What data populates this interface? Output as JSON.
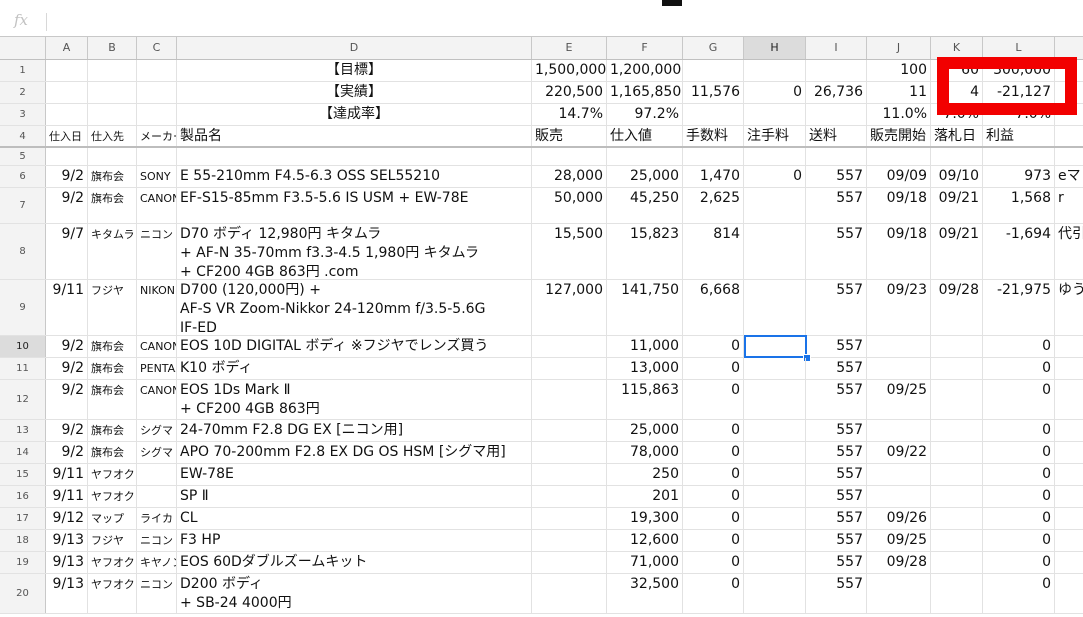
{
  "formula_bar": {
    "fx_label": "fx",
    "value": ""
  },
  "column_headers": [
    "A",
    "B",
    "C",
    "D",
    "E",
    "F",
    "G",
    "H",
    "I",
    "J",
    "K",
    "L"
  ],
  "selected_column": "H",
  "selected_row": "10",
  "rows": [
    {
      "n": "1",
      "cells": {
        "D": "【目標】",
        "E": "1,500,000",
        "F": "1,200,000",
        "J": "100",
        "K": "60",
        "L": "300,000"
      }
    },
    {
      "n": "2",
      "cells": {
        "D": "【実績】",
        "E": "220,500",
        "F": "1,165,850",
        "G": "11,576",
        "H": "0",
        "I": "26,736",
        "J": "11",
        "K": "4",
        "L": "-21,127"
      }
    },
    {
      "n": "3",
      "cells": {
        "D": "【達成率】",
        "E": "14.7%",
        "F": "97.2%",
        "J": "11.0%",
        "K": "7.0%",
        "L": "-7.0%"
      }
    },
    {
      "n": "4",
      "cells": {
        "A": "仕入日",
        "B": "仕入先",
        "C": "メーカー",
        "D": "製品名",
        "E": "販売",
        "F": "仕入値",
        "G": "手数料",
        "H": "注手料",
        "I": "送料",
        "J": "販売開始",
        "K": "落札日",
        "L": "利益"
      }
    },
    {
      "n": "5",
      "cells": {}
    },
    {
      "n": "6",
      "cells": {
        "A": "9/2",
        "B": "旗布会",
        "C": "SONY",
        "D": "E 55-210mm F4.5-6.3 OSS SEL55210",
        "E": "28,000",
        "F": "25,000",
        "G": "1,470",
        "H": "0",
        "I": "557",
        "J": "09/09",
        "K": "09/10",
        "L": "973",
        "M": "eマ"
      }
    },
    {
      "n": "7",
      "cells": {
        "A": "9/2",
        "B": "旗布会",
        "C": "CANON",
        "D": "EF-S15-85mm F3.5-5.6 IS USM + EW-78E",
        "E": "50,000",
        "F": "45,250",
        "G": "2,625",
        "I": "557",
        "J": "09/18",
        "K": "09/21",
        "L": "1,568",
        "M": "r"
      }
    },
    {
      "n": "8",
      "cells": {
        "A": "9/7",
        "B": "キタムラ",
        "C": "ニコン",
        "D": "D70 ボディ 12,980円 キタムラ\n+ AF-N 35-70mm f3.3-4.5 1,980円 キタムラ\n+ CF200 4GB 863円 .com",
        "E": "15,500",
        "F": "15,823",
        "G": "814",
        "I": "557",
        "J": "09/18",
        "K": "09/21",
        "L": "-1,694",
        "M": "代引"
      }
    },
    {
      "n": "9",
      "cells": {
        "A": "9/11",
        "B": "フジヤ",
        "C": "NIKON",
        "D": "D700 (120,000円) +\nAF-S VR Zoom-Nikkor 24-120mm f/3.5-5.6G\nIF-ED",
        "E": "127,000",
        "F": "141,750",
        "G": "6,668",
        "I": "557",
        "J": "09/23",
        "K": "09/28",
        "L": "-21,975",
        "M": "ゆう"
      }
    },
    {
      "n": "10",
      "cells": {
        "A": "9/2",
        "B": "旗布会",
        "C": "CANON",
        "D": "EOS 10D DIGITAL ボディ ※フジヤでレンズ買う",
        "F": "11,000",
        "G": "0",
        "I": "557",
        "L": "0"
      }
    },
    {
      "n": "11",
      "cells": {
        "A": "9/2",
        "B": "旗布会",
        "C": "PENTAX",
        "D": "K10 ボディ",
        "F": "13,000",
        "G": "0",
        "I": "557",
        "L": "0"
      }
    },
    {
      "n": "12",
      "cells": {
        "A": "9/2",
        "B": "旗布会",
        "C": "CANON",
        "D": "EOS 1Ds Mark Ⅱ\n+ CF200 4GB 863円",
        "F": "115,863",
        "G": "0",
        "I": "557",
        "J": "09/25",
        "L": "0"
      }
    },
    {
      "n": "13",
      "cells": {
        "A": "9/2",
        "B": "旗布会",
        "C": "シグマ",
        "D": "24-70mm F2.8 DG EX [ニコン用]",
        "F": "25,000",
        "G": "0",
        "I": "557",
        "L": "0"
      }
    },
    {
      "n": "14",
      "cells": {
        "A": "9/2",
        "B": "旗布会",
        "C": "シグマ",
        "D": "APO 70-200mm F2.8 EX DG OS HSM [シグマ用]",
        "F": "78,000",
        "G": "0",
        "I": "557",
        "J": "09/22",
        "L": "0"
      }
    },
    {
      "n": "15",
      "cells": {
        "A": "9/11",
        "B": "ヤフオク",
        "D": "EW-78E",
        "F": "250",
        "G": "0",
        "I": "557",
        "L": "0"
      }
    },
    {
      "n": "16",
      "cells": {
        "A": "9/11",
        "B": "ヤフオク",
        "D": "SP Ⅱ",
        "F": "201",
        "G": "0",
        "I": "557",
        "L": "0"
      }
    },
    {
      "n": "17",
      "cells": {
        "A": "9/12",
        "B": "マップ",
        "C": "ライカ",
        "D": "CL",
        "F": "19,300",
        "G": "0",
        "I": "557",
        "J": "09/26",
        "L": "0"
      }
    },
    {
      "n": "18",
      "cells": {
        "A": "9/13",
        "B": "フジヤ",
        "C": "ニコン",
        "D": "F3 HP",
        "F": "12,600",
        "G": "0",
        "I": "557",
        "J": "09/25",
        "L": "0"
      }
    },
    {
      "n": "19",
      "cells": {
        "A": "9/13",
        "B": "ヤフオク",
        "C": "キヤノン",
        "D": "EOS 60Dダブルズームキット",
        "F": "71,000",
        "G": "0",
        "I": "557",
        "J": "09/28",
        "L": "0"
      }
    },
    {
      "n": "20",
      "cells": {
        "A": "9/13",
        "B": "ヤフオク",
        "C": "ニコン",
        "D": "D200 ボディ\n+ SB-24 4000円",
        "F": "32,500",
        "G": "0",
        "I": "557",
        "L": "0"
      }
    }
  ],
  "highlight_color": "#f20000",
  "selection_color": "#1a73e8"
}
